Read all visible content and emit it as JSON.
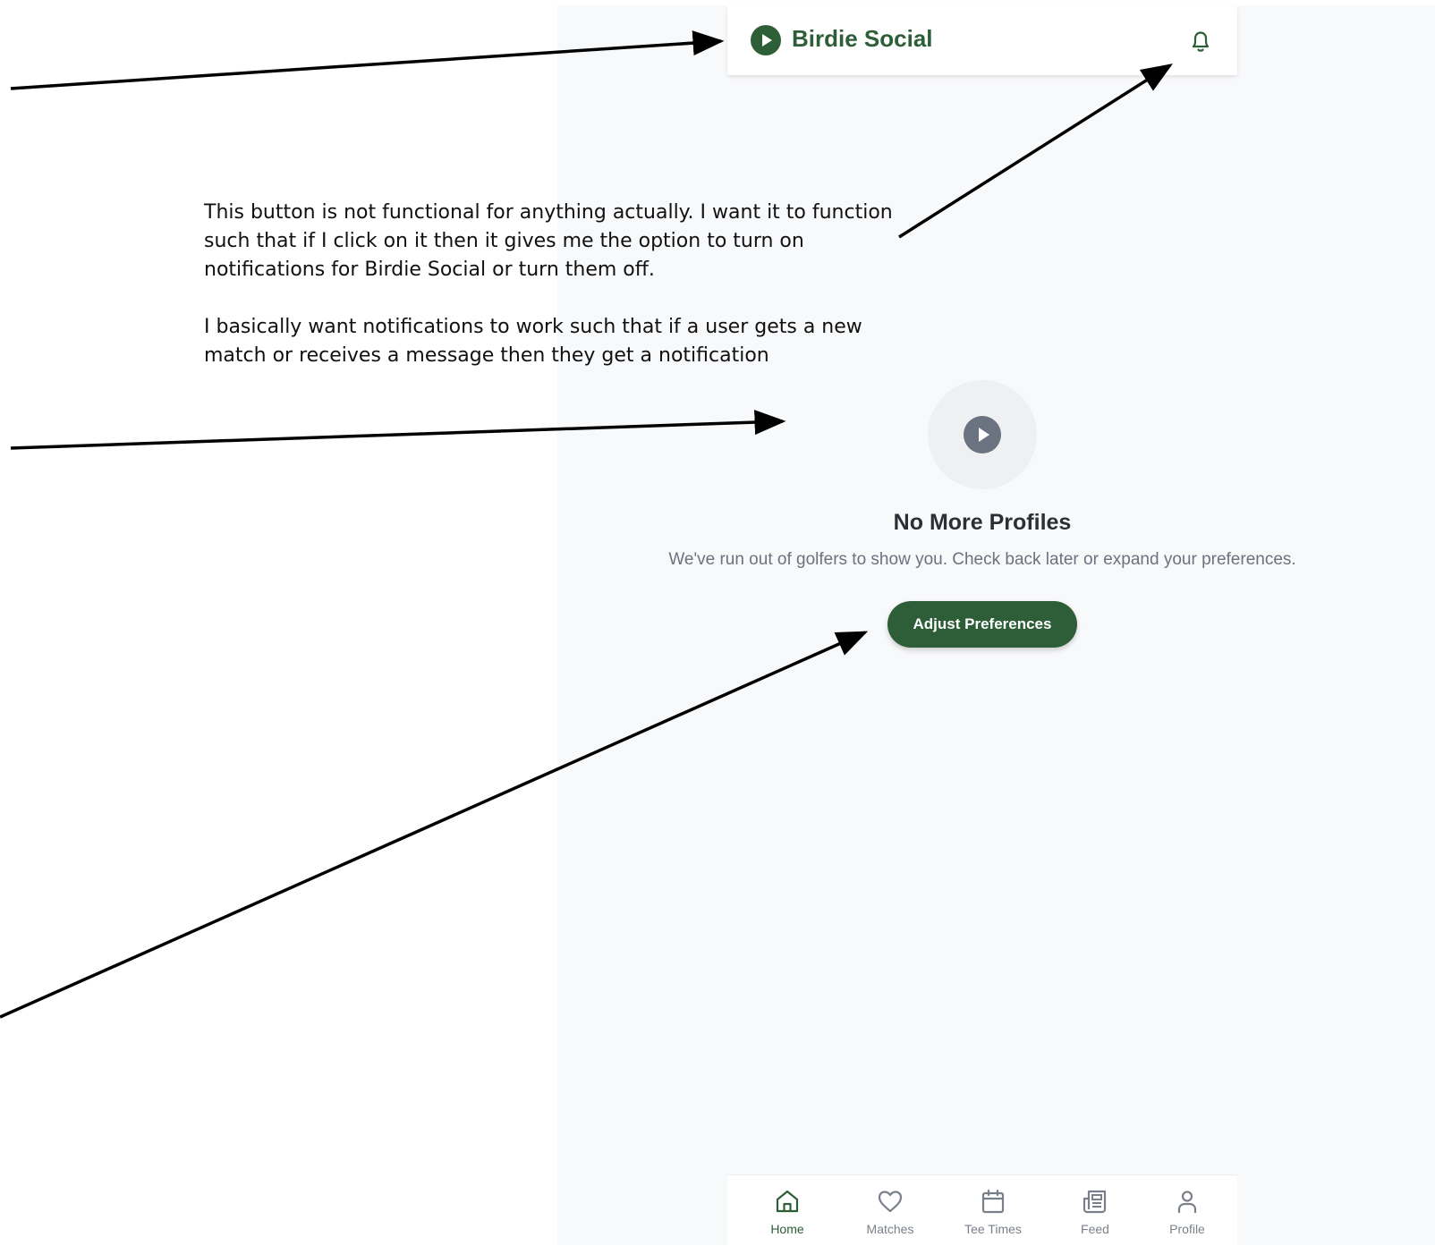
{
  "header": {
    "brand": "Birdie Social"
  },
  "annotation": {
    "paragraph_1": "This button is not functional for anything actually. I want it to function such that if I click on it then it gives me the option to turn on notifications for Birdie Social or turn them off.",
    "paragraph_2": "I basically want notifications to work such that if a user gets a new match or receives a message then they get a notification"
  },
  "empty_state": {
    "title": "No More Profiles",
    "message": "We've run out of golfers to show you. Check back later or expand your preferences.",
    "button_label": "Adjust Preferences"
  },
  "bottom_nav": {
    "items": [
      {
        "label": "Home",
        "icon": "home-icon",
        "active": true
      },
      {
        "label": "Matches",
        "icon": "heart-icon",
        "active": false
      },
      {
        "label": "Tee Times",
        "icon": "calendar-icon",
        "active": false
      },
      {
        "label": "Feed",
        "icon": "newspaper-icon",
        "active": false
      },
      {
        "label": "Profile",
        "icon": "user-icon",
        "active": false
      }
    ]
  },
  "colors": {
    "brand_green": "#2d5e37",
    "nav_inactive": "#7a808a",
    "background": "#f8f9fb"
  }
}
